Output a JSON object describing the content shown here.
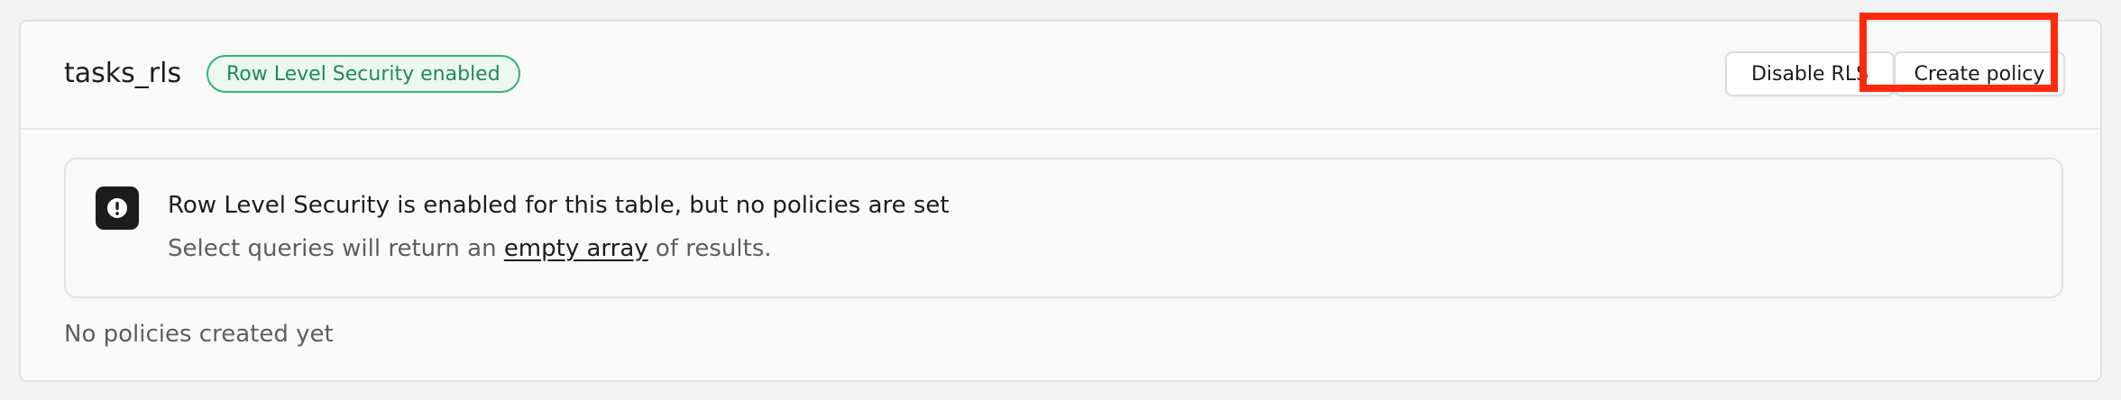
{
  "header": {
    "table_name": "tasks_rls",
    "rls_badge": "Row Level Security enabled",
    "disable_rls_label": "Disable RLS",
    "create_policy_label": "Create policy"
  },
  "notice": {
    "icon": "alert-icon",
    "title": "Row Level Security is enabled for this table, but no policies are set",
    "text_before": "Select queries will return an ",
    "link_text": "empty array",
    "text_after": " of results."
  },
  "empty_state": "No policies created yet",
  "colors": {
    "badge_border": "#34b27b",
    "badge_text": "#1f8a5a",
    "highlight": "#ff2a0c"
  }
}
